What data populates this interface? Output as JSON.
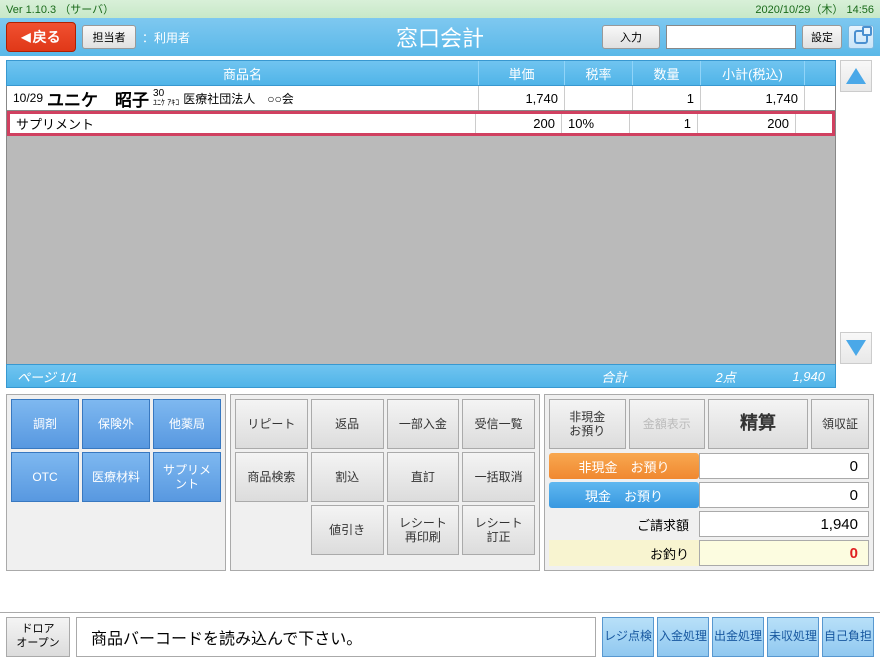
{
  "version_bar": {
    "version": "Ver 1.10.3 （サーバ）",
    "datetime": "2020/10/29（木） 14:56"
  },
  "title_bar": {
    "back": "戻る",
    "staff_btn": "担当者",
    "staff_label": "：利用者",
    "title": "窓口会計",
    "input_btn": "入力",
    "input_value": "",
    "settings": "設定"
  },
  "table": {
    "headers": {
      "name": "商品名",
      "price": "単価",
      "tax": "税率",
      "qty": "数量",
      "subtotal": "小計(税込)"
    },
    "rows": [
      {
        "kind": "patient",
        "date": "10/29",
        "name": "ユニケ　昭子",
        "age": "30",
        "kana": "ﾕﾆｹ ｱｷｺ",
        "org": "医療社団法人　○○会",
        "price": "1,740",
        "tax": "",
        "qty": "1",
        "subtotal": "1,740"
      },
      {
        "kind": "item",
        "name": "サプリメント",
        "price": "200",
        "tax": "10%",
        "qty": "1",
        "subtotal": "200"
      }
    ],
    "footer": {
      "page": "ページ  1/1",
      "sum_label": "合計",
      "qty_sum": "2点",
      "sub_sum": "1,940"
    }
  },
  "panel_left": [
    "調剤",
    "保険外",
    "他薬局",
    "OTC",
    "医療材料",
    "サプリメント"
  ],
  "panel_mid": [
    "リピート",
    "返品",
    "一部入金",
    "受信一覧",
    "商品検索",
    "割込",
    "直訂",
    "一括取消",
    "",
    "値引き",
    "レシート再印刷",
    "レシート訂正"
  ],
  "panel_right": {
    "top": [
      "非現金お預り",
      "金額表示",
      "精算",
      "領収証"
    ],
    "rows": [
      {
        "style": "orange",
        "label": "非現金　お預り",
        "value": "0"
      },
      {
        "style": "blue",
        "label": "現金　お預り",
        "value": "0"
      },
      {
        "style": "plain",
        "label": "ご請求額",
        "value": "1,940"
      },
      {
        "style": "change",
        "label": "お釣り",
        "value": "0"
      }
    ]
  },
  "bottom": {
    "drawer": "ドロア\nオープン",
    "hint": "商品バーコードを読み込んで下さい。",
    "buttons": [
      "レジ点検",
      "入金処理",
      "出金処理",
      "未収処理",
      "自己負担"
    ]
  }
}
